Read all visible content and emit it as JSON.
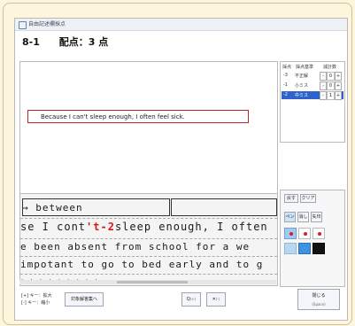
{
  "window": {
    "title": "自由記述欄採点"
  },
  "header": {
    "question_no": "8-1",
    "score_label": "配点：3 点"
  },
  "typed_answer": "Because I can't sleep enough, I often feel sick.",
  "handwriting": {
    "line1": "→ between",
    "line2_pre": "se  I  cont",
    "line2_mark": "'t-2",
    "line2_post": "sleep  enough,  I  often",
    "line3": "e  been  absent  from  school  for  a  we",
    "line4": "  impotant  to  go  to  bed  early  and  to  g",
    "line5": "  ·  ·  ·   ·   ·   ·   ·   ·   ·"
  },
  "rubric": {
    "headers": [
      "採点",
      "採点基準",
      "減計数"
    ],
    "rows": [
      {
        "mark": "-3",
        "label": "不正解",
        "value": "0",
        "selected": false
      },
      {
        "mark": "-1",
        "label": "小ミス",
        "value": "0",
        "selected": false
      },
      {
        "mark": "-2",
        "label": "中ミス",
        "value": "1",
        "selected": true
      }
    ],
    "minus": "-",
    "plus": "+"
  },
  "tools": {
    "undo": "戻す",
    "clear": "クリア",
    "pen": "ペン",
    "none": "消し",
    "eraser": "矢印"
  },
  "colors": {
    "light_blue": "#9fcaf2",
    "white": "#ffffff",
    "red": "#d42020",
    "pale_blue": "#b9d7f1",
    "mid_blue": "#3f92dd",
    "black": "#111111"
  },
  "footer": {
    "hint_line1": "[+] キー：拡大",
    "hint_line2": "[-] キー：縮小",
    "to_target": "対象解答集へ",
    "zoom_in_icon": "Q",
    "zoom_in_key": "(+)",
    "close_x": "✕",
    "close_x_key": "(-)",
    "close_label": "閉じる",
    "close_key": "(Space)"
  }
}
